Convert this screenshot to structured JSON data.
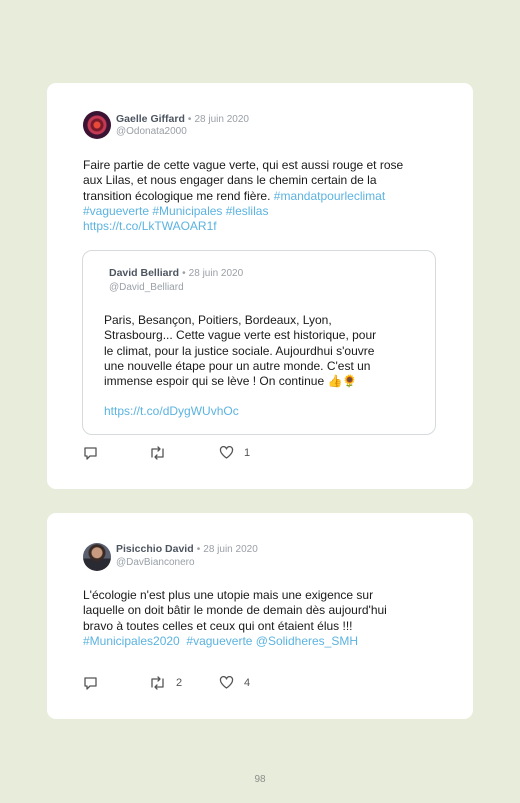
{
  "tweets": [
    {
      "author": "Gaelle Giffard",
      "separator": "•",
      "date": "28 juin 2020",
      "handle": "@Odonata2000",
      "text_lines": [
        "Faire partie de cette vague verte, qui est aussi rouge et rose",
        "aux Lilas, et nous engager dans le chemin certain de la",
        "transition écologique me rend fière. "
      ],
      "hashtag_inline": "#mandatpourleclimat",
      "hashtags_line": "#vagueverte #Municipales #leslilas",
      "url": "https://t.co/LkTWAOAR1f",
      "quoted": {
        "author": "David Belliard",
        "separator": "•",
        "date": "28 juin 2020",
        "handle": "@David_Belliard",
        "text_lines": [
          "Paris, Besançon, Poitiers, Bordeaux, Lyon,",
          "Strasbourg... Cette vague verte est historique, pour",
          "le climat, pour la justice sociale. Aujourdhui s'ouvre",
          "une nouvelle étape pour un autre monde. C'est un",
          "immense espoir qui se lève ! On continue 👍🌻"
        ],
        "url": "https://t.co/dDygWUvhOc"
      },
      "retweets": "",
      "likes": "1"
    },
    {
      "author": "Pisicchio David",
      "separator": "•",
      "date": "28 juin 2020",
      "handle": "@DavBianconero",
      "text_lines": [
        "L'écologie n'est plus une utopie mais une exigence sur",
        "laquelle on doit bâtir le monde de demain dès aujourd'hui",
        "bravo à toutes celles et ceux qui ont étaient élus !!!"
      ],
      "hashtags_line": "#Municipales2020  #vagueverte @Solidheres_SMH",
      "retweets": "2",
      "likes": "4"
    }
  ],
  "page_number": "98",
  "colors": {
    "background": "#e8ecdb",
    "link": "#5bb3e0",
    "card": "#ffffff"
  }
}
